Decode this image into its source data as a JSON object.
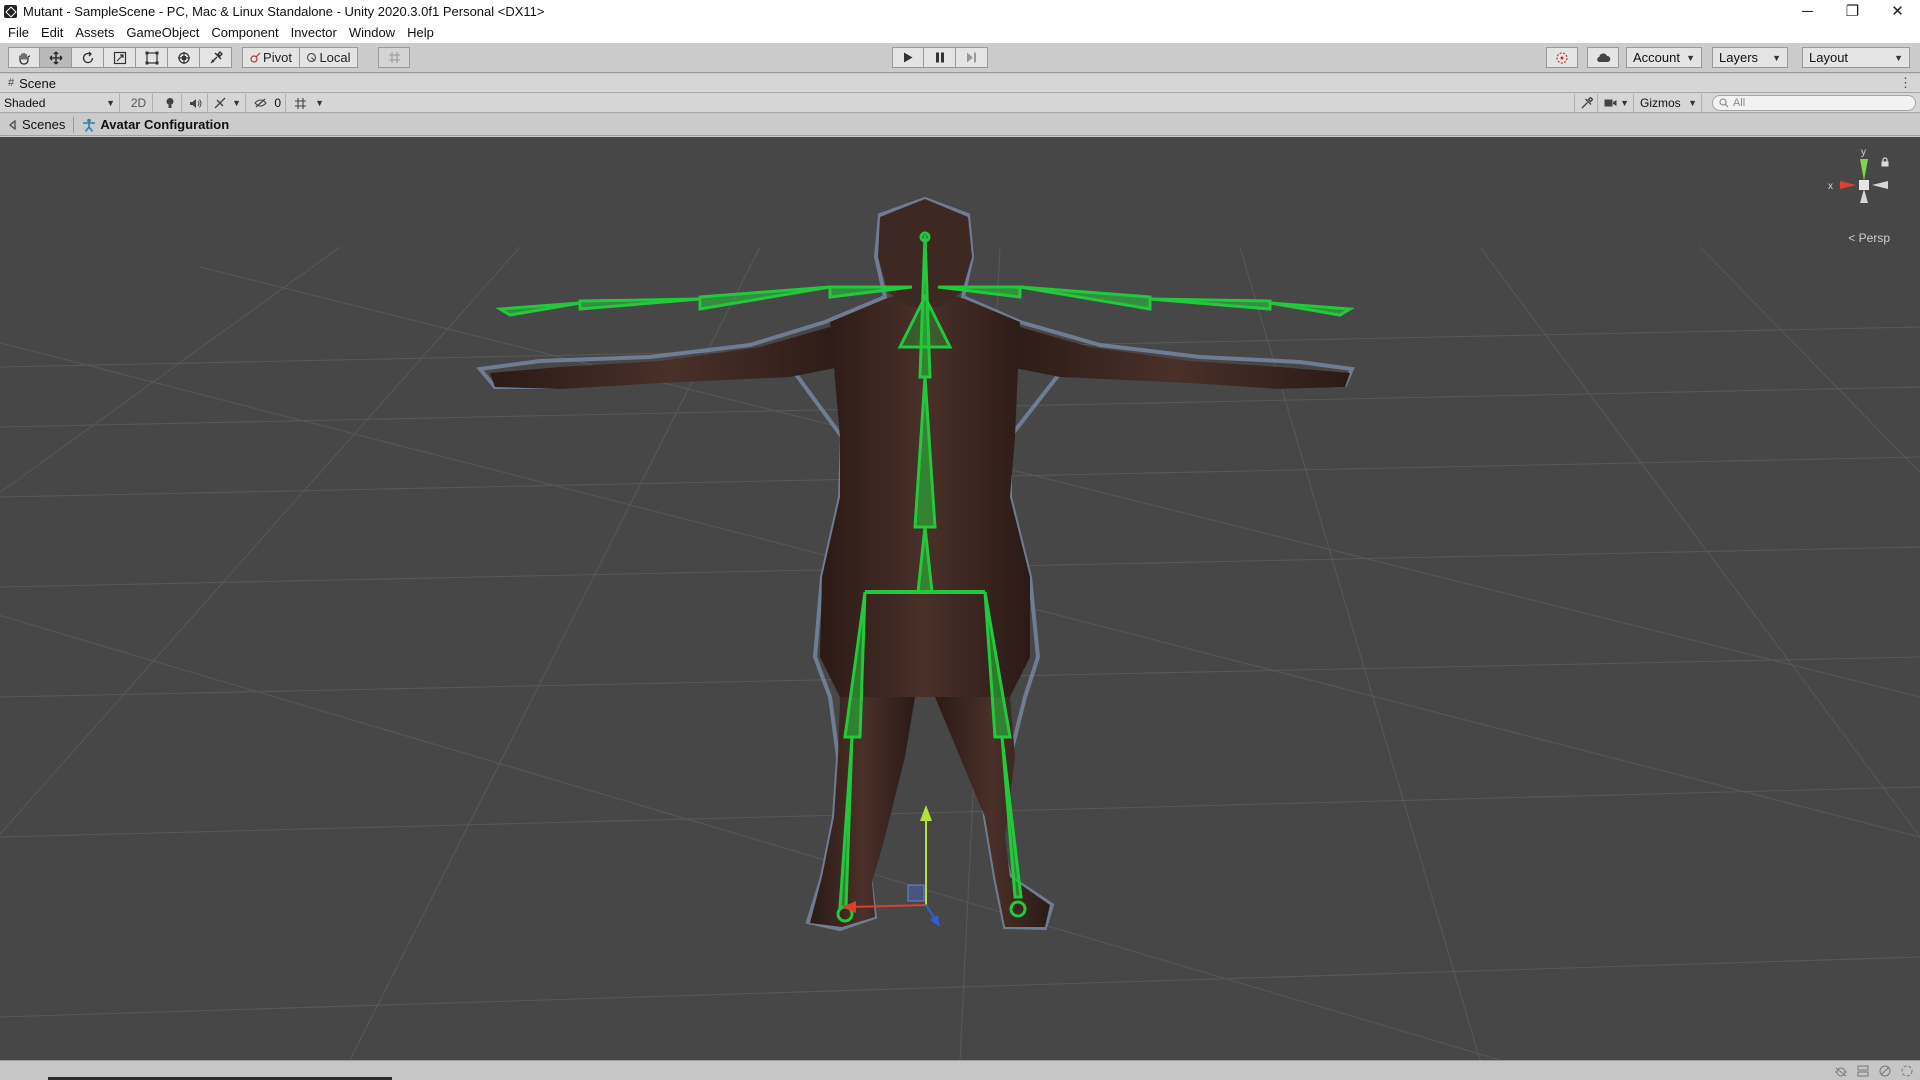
{
  "window": {
    "title": "Mutant - SampleScene - PC, Mac & Linux Standalone - Unity 2020.3.0f1 Personal <DX11>",
    "controls": {
      "minimize": "─",
      "restore": "❐",
      "close": "✕"
    }
  },
  "menu": [
    "File",
    "Edit",
    "Assets",
    "GameObject",
    "Component",
    "Invector",
    "Window",
    "Help"
  ],
  "toolbar": {
    "tools": [
      "hand-tool-icon",
      "move-tool-icon",
      "rotate-tool-icon",
      "scale-tool-icon",
      "rect-tool-icon",
      "transform-tool-icon",
      "custom-tool-icon"
    ],
    "active_tool": "move-tool-icon",
    "pivot_label": "Pivot",
    "local_label": "Local",
    "account_label": "Account",
    "layers_label": "Layers",
    "layout_label": "Layout"
  },
  "scene_tab": {
    "label": "Scene"
  },
  "scene_toolbar": {
    "shading_mode": "Shaded",
    "mode_2d": "2D",
    "hidden_count": "0",
    "gizmos_label": "Gizmos",
    "search_placeholder": "All"
  },
  "breadcrumb": {
    "scenes_label": "Scenes",
    "avatar_label": "Avatar Configuration"
  },
  "viewport": {
    "background_color": "#474747",
    "grid_color": "#5a5a5a",
    "bone_color": "#22c93a",
    "skin_color": "#3b2620",
    "outline_color": "#7f93b5",
    "projection_label": "< Persp",
    "axis_labels": {
      "x": "x",
      "y": "y"
    }
  }
}
